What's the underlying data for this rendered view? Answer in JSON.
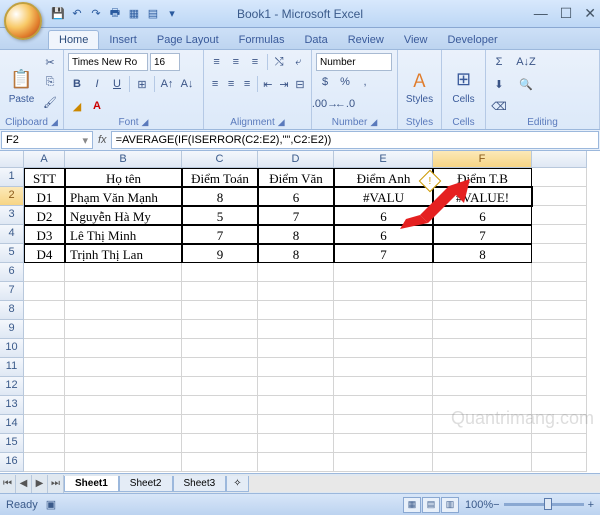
{
  "window": {
    "title": "Book1 - Microsoft Excel"
  },
  "tabs": [
    "Home",
    "Insert",
    "Page Layout",
    "Formulas",
    "Data",
    "Review",
    "View",
    "Developer"
  ],
  "active_tab": "Home",
  "ribbon": {
    "clipboard": {
      "label": "Clipboard",
      "paste": "Paste"
    },
    "font": {
      "label": "Font",
      "name": "Times New Ro",
      "size": "16"
    },
    "alignment": {
      "label": "Alignment"
    },
    "number": {
      "label": "Number",
      "format": "Number"
    },
    "styles": {
      "label": "Styles",
      "btn": "Styles"
    },
    "cells": {
      "label": "Cells",
      "btn": "Cells"
    },
    "editing": {
      "label": "Editing"
    }
  },
  "namebox": "F2",
  "formula": "=AVERAGE(IF(ISERROR(C2:E2),\"\",C2:E2))",
  "columns": [
    "A",
    "B",
    "C",
    "D",
    "E",
    "F"
  ],
  "table": {
    "headers": [
      "STT",
      "Họ tên",
      "Điểm Toán",
      "Điểm Văn",
      "Điểm Anh",
      "Điểm T.B"
    ],
    "rows": [
      [
        "D1",
        "Phạm Văn Mạnh",
        "8",
        "6",
        "#VALUE!",
        "#VALUE!"
      ],
      [
        "D2",
        "Nguyễn Hà My",
        "5",
        "7",
        "6",
        "6"
      ],
      [
        "D3",
        "Lê Thị Minh",
        "7",
        "8",
        "6",
        "7"
      ],
      [
        "D4",
        "Trịnh Thị Lan",
        "9",
        "8",
        "7",
        "8"
      ]
    ]
  },
  "sheets": [
    "Sheet1",
    "Sheet2",
    "Sheet3"
  ],
  "active_sheet": "Sheet1",
  "status": {
    "ready": "Ready",
    "zoom": "100%"
  },
  "watermark": "Quantrimang.com"
}
